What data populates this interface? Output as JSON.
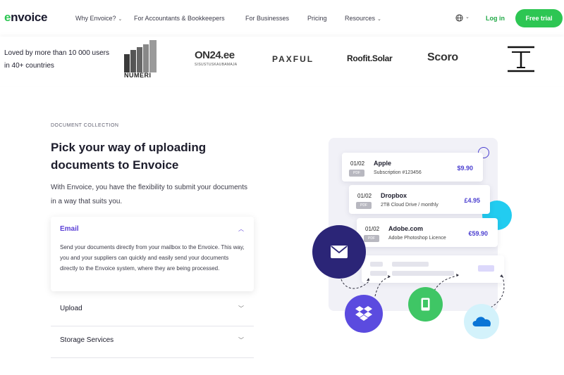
{
  "nav": {
    "logo_prefix": "e",
    "logo_rest": "nvoice",
    "items": [
      {
        "label": "Why Envoice?",
        "dropdown": true
      },
      {
        "label": "For Accountants & Bookkeepers",
        "dropdown": false
      },
      {
        "label": "For Businesses",
        "dropdown": false
      },
      {
        "label": "Pricing",
        "dropdown": false
      },
      {
        "label": "Resources",
        "dropdown": true
      }
    ],
    "login": "Log in",
    "trial": "Free trial",
    "brand_color": "#2dc653"
  },
  "clients": {
    "tagline": "Loved by more than 10 000 users in 40+ countries",
    "logos": [
      "NUMERI",
      "ON24.ee",
      "SISUSTUSKAUBAMAJA",
      "PAXFUL",
      "Roofit.Solar",
      "Scoro",
      "T"
    ]
  },
  "section": {
    "eyebrow": "DOCUMENT COLLECTION",
    "heading": "Pick your way of uploading documents to Envoice",
    "intro": "With Envoice, you have the flexibility to submit your documents in a way that suits you.",
    "accordion": [
      {
        "title": "Email",
        "expanded": true,
        "body": "Send your documents directly from your mailbox to the Envoice. This way, you and your suppliers can quickly and easily send your documents directly to the Envoice system, where they are being processed."
      },
      {
        "title": "Upload",
        "expanded": false
      },
      {
        "title": "Storage Services",
        "expanded": false
      }
    ],
    "accent_color": "#5b3fd6"
  },
  "illustration": {
    "invoices": [
      {
        "date": "01/02",
        "tag": "PDF",
        "name": "Apple",
        "desc": "Subscription #123456",
        "amount": "$9.90"
      },
      {
        "date": "01/02",
        "tag": "PDF",
        "name": "Dropbox",
        "desc": "2TB Cloud Drive / monthly",
        "amount": "£4.95"
      },
      {
        "date": "01/02",
        "tag": "PDF",
        "name": "Adobe.com",
        "desc": "Adobe Photoshop Licence",
        "amount": "€59.90"
      }
    ],
    "sources": [
      "mail-icon",
      "dropbox-icon",
      "phone-icon",
      "onedrive-icon"
    ]
  }
}
